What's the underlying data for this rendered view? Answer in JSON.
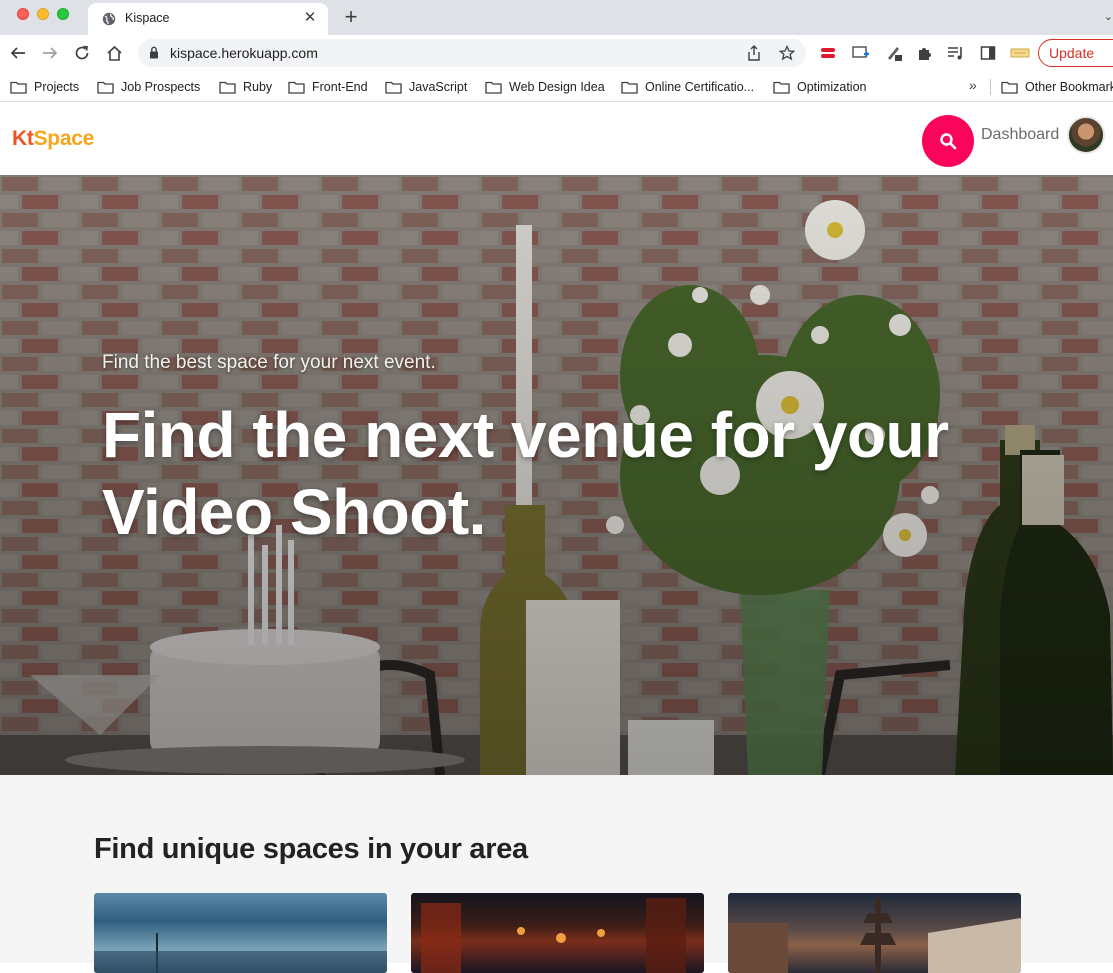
{
  "browser": {
    "tab_title": "Kispace",
    "url": "kispace.herokuapp.com",
    "update_label": "Update",
    "bookmarks": [
      "Projects",
      "Job Prospects",
      "Ruby",
      "Front-End",
      "JavaScript",
      "Web Design Idea",
      "Online Certificatio...",
      "Optimization"
    ],
    "other_bookmarks": "Other Bookmarks"
  },
  "site": {
    "logo_k": "K",
    "logo_t": "t",
    "logo_rest": "Space",
    "dashboard_label": "Dashboard",
    "accent_color": "#f9065c"
  },
  "hero": {
    "eyebrow": "Find the best space for your next event.",
    "title_line1": "Find the next venue for your",
    "title_line2": "Video Shoot."
  },
  "section": {
    "title": "Find unique spaces in your area"
  }
}
